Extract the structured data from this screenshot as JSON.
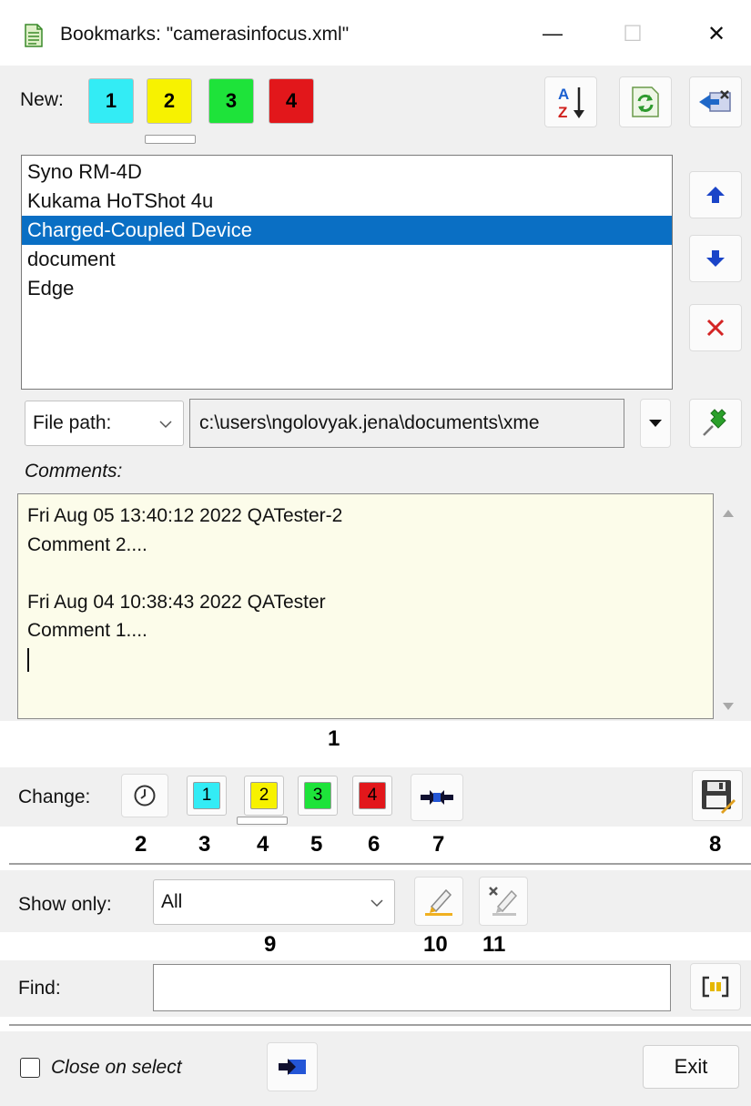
{
  "window": {
    "title": "Bookmarks: \"camerasinfocus.xml\"",
    "minimize_glyph": "—",
    "maximize_glyph": "☐",
    "close_glyph": "✕",
    "icon": "document-icon"
  },
  "new_section": {
    "label": "New:",
    "buttons": [
      {
        "label": "1",
        "color": "#33ecf5"
      },
      {
        "label": "2",
        "color": "#f7f200"
      },
      {
        "label": "3",
        "color": "#1ee33a"
      },
      {
        "label": "4",
        "color": "#e2171b"
      }
    ],
    "selected_index": 1,
    "icons": [
      "sort-az-icon",
      "refresh-icon",
      "import-icon"
    ],
    "sort_top": "A",
    "sort_bottom": "Z"
  },
  "bookmarks": {
    "items": [
      "Syno RM-4D",
      "Kukama HoTShot 4u",
      "Charged-Coupled Device",
      "document",
      "Edge"
    ],
    "selected_index": 2,
    "side_icons": [
      "move-up-icon",
      "move-down-icon",
      "delete-icon"
    ]
  },
  "file_path": {
    "selector_value": "File path:",
    "path_value": "c:\\users\\ngolovyak.jena\\documents\\xme",
    "icons": [
      "dropdown-arrow-icon",
      "pin-icon"
    ]
  },
  "comments": {
    "label": "Comments:",
    "lines": [
      "Fri Aug 05 13:40:12 2022 QATester-2",
      "Comment 2....",
      "",
      "Fri Aug 04 10:38:43 2022 QATester",
      "Comment 1...."
    ]
  },
  "change_section": {
    "label": "Change:",
    "buttons": [
      {
        "label": "1",
        "color": "#33ecf5"
      },
      {
        "label": "2",
        "color": "#f7f200"
      },
      {
        "label": "3",
        "color": "#1ee33a"
      },
      {
        "label": "4",
        "color": "#e2171b"
      }
    ],
    "selected_index": 1,
    "icons": [
      "clock-icon",
      "jump-arrows-icon",
      "save-icon"
    ]
  },
  "show_only": {
    "label": "Show only:",
    "value": "All",
    "icons": [
      "highlighter-icon",
      "clear-highlight-icon"
    ]
  },
  "find": {
    "label": "Find:",
    "value": "",
    "icon": "find-brackets-icon"
  },
  "footer": {
    "close_on_select_label": "Close on select",
    "close_on_select_checked": false,
    "goto_icon": "goto-arrow-icon",
    "exit_label": "Exit"
  },
  "callouts": {
    "n1": "1",
    "n2": "2",
    "n3": "3",
    "n4": "4",
    "n5": "5",
    "n6": "6",
    "n7": "7",
    "n8": "8",
    "n9": "9",
    "n10": "10",
    "n11": "11"
  }
}
